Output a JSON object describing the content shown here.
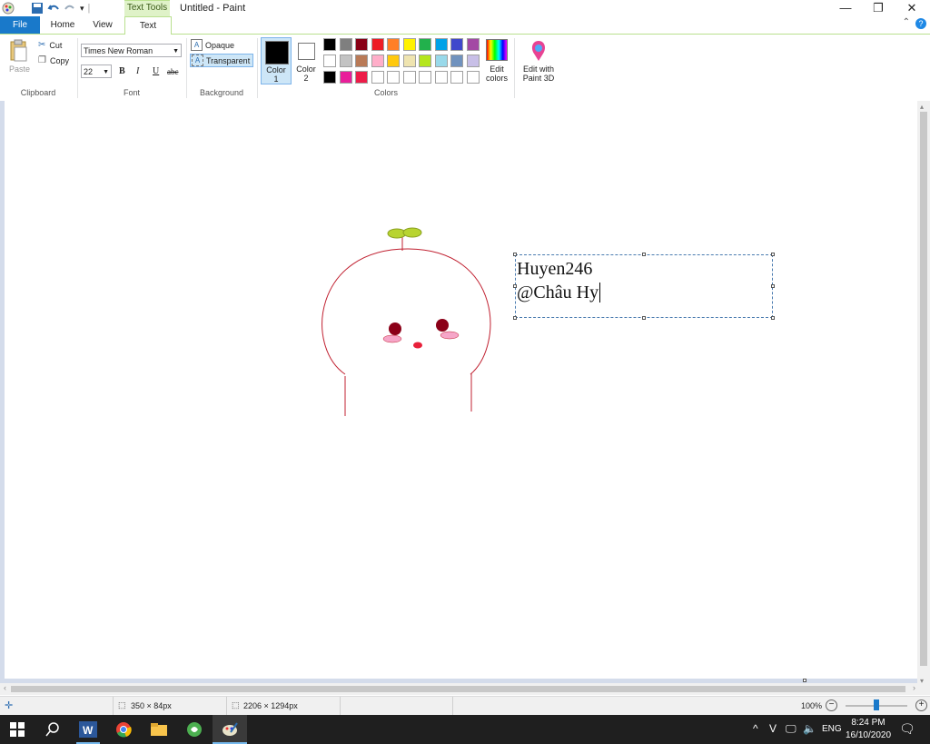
{
  "window": {
    "title": "Untitled - Paint",
    "context_tab": "Text Tools"
  },
  "tabs": {
    "file": "File",
    "home": "Home",
    "view": "View",
    "text": "Text"
  },
  "ribbon": {
    "clipboard": {
      "paste": "Paste",
      "cut": "Cut",
      "copy": "Copy",
      "label": "Clipboard"
    },
    "font": {
      "family": "Times New Roman",
      "size": "22",
      "bold": "B",
      "italic": "I",
      "underline": "U",
      "strike": "abc",
      "label": "Font"
    },
    "background": {
      "opaque": "Opaque",
      "transparent": "Transparent",
      "label": "Background"
    },
    "colors": {
      "color1": "Color\n1",
      "color1_l1": "Color",
      "color1_l2": "1",
      "color2_l1": "Color",
      "color2_l2": "2",
      "edit_l1": "Edit",
      "edit_l2": "colors",
      "label": "Colors",
      "palette": [
        "#000000",
        "#7f7f7f",
        "#880015",
        "#ed1c24",
        "#ff7f27",
        "#fff200",
        "#22b14c",
        "#00a2e8",
        "#3f48cc",
        "#a349a4",
        "#ffffff",
        "#c3c3c3",
        "#b97a57",
        "#ffaec9",
        "#ffc90e",
        "#efe4b0",
        "#b5e61d",
        "#99d9ea",
        "#7092be",
        "#c8bfe7",
        "#000000",
        "#e91e9a",
        "#ed1c48",
        "#ffffff",
        "#ffffff",
        "#ffffff",
        "#ffffff",
        "#ffffff",
        "#ffffff",
        "#ffffff"
      ]
    },
    "paint3d": {
      "l1": "Edit with",
      "l2": "Paint 3D"
    }
  },
  "canvas": {
    "text_line1": "Huyen246",
    "text_line2": "@Châu Hy",
    "drawing_color": "#d02030"
  },
  "status": {
    "selection_size": "350 × 84px",
    "image_size": "2206 × 1294px",
    "zoom": "100%"
  },
  "taskbar": {
    "lang": "ENG",
    "time": "8:24 PM",
    "date": "16/10/2020"
  }
}
